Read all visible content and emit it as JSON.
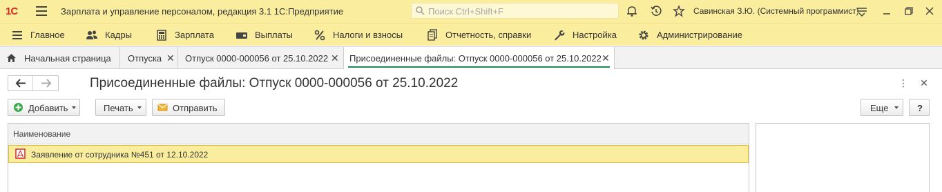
{
  "titlebar": {
    "logo": "1С",
    "app_title": "Зарплата и управление персоналом, редакция 3.1 1С:Предприятие",
    "search_placeholder": "Поиск Ctrl+Shift+F",
    "user": "Савинская З.Ю. (Системный программист)"
  },
  "menu": [
    {
      "label": "Главное",
      "icon": "hamburger-icon"
    },
    {
      "label": "Кадры",
      "icon": "people-icon"
    },
    {
      "label": "Зарплата",
      "icon": "calculator-icon"
    },
    {
      "label": "Выплаты",
      "icon": "wallet-icon"
    },
    {
      "label": "Налоги и взносы",
      "icon": "percent-icon"
    },
    {
      "label": "Отчетность, справки",
      "icon": "documents-icon"
    },
    {
      "label": "Настройка",
      "icon": "wrench-icon"
    },
    {
      "label": "Администрирование",
      "icon": "gear-icon"
    }
  ],
  "tabs": [
    {
      "label": "Начальная страница",
      "icon": "home-icon"
    },
    {
      "label": "Отпуска"
    },
    {
      "label": "Отпуск 0000-000056 от 25.10.2022"
    },
    {
      "label": "Присоединенные файлы: Отпуск 0000-000056 от 25.10.2022"
    }
  ],
  "form": {
    "title": "Присоединенные файлы: Отпуск 0000-000056 от 25.10.2022"
  },
  "toolbar": {
    "add_label": "Добавить",
    "print_label": "Печать",
    "send_label": "Отправить",
    "more_label": "Еще",
    "help_label": "?"
  },
  "table": {
    "column_header": "Наименование",
    "rows": [
      {
        "name": "Заявление от сотрудника №451 от 12.10.2022"
      }
    ]
  },
  "colors": {
    "accent_yellow": "#fbed9e",
    "active_tab_underline": "#1a8a5a",
    "logo_red": "#d8282b"
  }
}
